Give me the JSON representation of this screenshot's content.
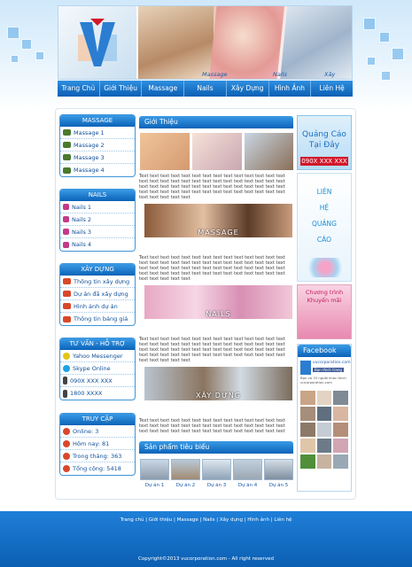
{
  "header": {
    "logo_letter": "V",
    "hero_labels": [
      "Massage",
      "Nails",
      "Xây Dựng"
    ]
  },
  "nav": [
    "Trang Chủ",
    "Giới Thiệu",
    "Massage",
    "Nails",
    "Xây Dựng",
    "Hình Ảnh",
    "Liên Hệ"
  ],
  "sidebar": {
    "massage": {
      "title": "MASSAGE",
      "items": [
        "Massage 1",
        "Massage 2",
        "Massage 3",
        "Massage 4"
      ]
    },
    "nails": {
      "title": "NAILS",
      "items": [
        "Nails 1",
        "Nails 2",
        "Nails 3",
        "Nails 4"
      ]
    },
    "xaydung": {
      "title": "XÂY DỰNG",
      "items": [
        "Thông tin xây dựng",
        "Dự án đã xây dựng",
        "Hình ảnh dự án",
        "Thông tin báng giá"
      ]
    },
    "support": {
      "title": "TƯ VẤN - HỖ TRỢ",
      "items": [
        "Yahoo Messenger",
        "Skype Online",
        "090X XXX XXX",
        "1800 XXXX"
      ]
    },
    "stats": {
      "title": "TRUY CẬP",
      "items": [
        "Online: 3",
        "Hôm nay: 81",
        "Trong tháng: 363",
        "Tổng cộng: 5418"
      ]
    }
  },
  "main": {
    "intro_title": "Giới Thiệu",
    "lorem": "Text text text text text text text text text text text text text text text text text text text text text text text text text text text text text text text text text text text text text text text text text text text text text text text text text text text text text text text text text text text text text",
    "banners": [
      "MASSAGE",
      "NAILS",
      "XÂY DỰNG"
    ],
    "products_title": "Sản phẩm tiêu biểu",
    "products": [
      "Dự án 1",
      "Dự án 2",
      "Dự án 3",
      "Dự án 4",
      "Dự án 5"
    ]
  },
  "right": {
    "ad1_line1": "Quảng Cáo",
    "ad1_line2": "Tại Đây",
    "ad1_phone": "090X XXX XXX",
    "ad2": [
      "LIÊN",
      "HỆ",
      "QUẢNG",
      "CÁO"
    ],
    "ad3_line1": "Chương trình",
    "ad3_line2": "Khuyến mãi",
    "facebook_title": "Facebook",
    "fb_page": "vucorporation.com",
    "fb_like": "Bạn thích trang",
    "fb_count": "Bạn và 33 người khác thích vucorporation.com"
  },
  "footer": {
    "links": "Trang chủ | Giới thiệu | Massage | Nails | Xây dựng | Hình ảnh | Liên hệ",
    "copyright": "Copyright©2013 vucorporation.com - All right reserved"
  },
  "colors": {
    "primary": "#0b63b8",
    "accent": "#3a9be6",
    "ad_red": "#d2182a"
  }
}
